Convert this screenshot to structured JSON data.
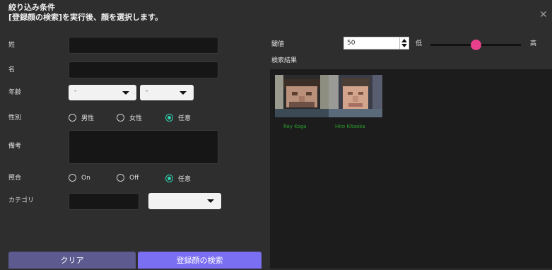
{
  "dialog": {
    "title_line1": "絞り込み条件",
    "title_line2": "[登録顔の検索]を実行後、顔を選択します。",
    "close_glyph": "✕"
  },
  "form": {
    "last_name_label": "姓",
    "first_name_label": "名",
    "age_label": "年齢",
    "age_from": "-",
    "age_separator": "~",
    "age_to": "-",
    "gender_label": "性別",
    "gender_options": [
      "男性",
      "女性",
      "任意"
    ],
    "gender_selected": "任意",
    "notes_label": "備考",
    "match_label": "照合",
    "match_options": [
      "On",
      "Off",
      "任意"
    ],
    "match_selected": "任意",
    "category_label": "カテゴリ"
  },
  "buttons": {
    "clear": "クリア",
    "search": "登録顔の検索"
  },
  "threshold": {
    "label": "閾値",
    "value": "50",
    "low_label": "低",
    "high_label": "高",
    "slider_fraction": 0.5
  },
  "results": {
    "label": "検索結果",
    "faces": [
      {
        "name": "Roy Koga"
      },
      {
        "name": "Hiro Kitaoka"
      }
    ]
  },
  "colors": {
    "accent_radio": "#2fd0b0",
    "slider_handle": "#e8408c",
    "search_button": "#7a6ef2",
    "clear_button": "#5c5a8e",
    "result_name": "#2ca12c"
  }
}
